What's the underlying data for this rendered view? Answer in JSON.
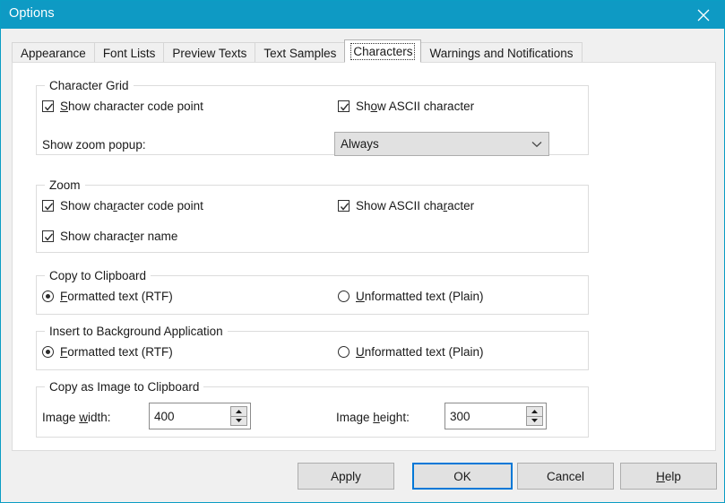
{
  "window": {
    "title": "Options",
    "close_icon": "close-icon",
    "accent_color": "#0e9ac4"
  },
  "tabs": [
    {
      "label": "Appearance",
      "active": false
    },
    {
      "label": "Font Lists",
      "active": false
    },
    {
      "label": "Preview Texts",
      "active": false
    },
    {
      "label": "Text Samples",
      "active": false
    },
    {
      "label": "Characters",
      "active": true
    },
    {
      "label": "Warnings and Notifications",
      "active": false
    }
  ],
  "groups": {
    "character_grid": {
      "legend": "Character Grid",
      "show_code_point": {
        "label": "Show character code point",
        "accel": "S",
        "checked": true
      },
      "show_ascii": {
        "label": "Show ASCII character",
        "accel": "o",
        "checked": true
      },
      "zoom_popup_label": "Show zoom popup:",
      "zoom_popup_value": "Always",
      "zoom_popup_options": [
        "Always"
      ],
      "dropdown_icon": "chevron-down-icon"
    },
    "zoom": {
      "legend": "Zoom",
      "show_code_point": {
        "label": "Show character code point",
        "accel": "r",
        "checked": true
      },
      "show_ascii": {
        "label": "Show ASCII character",
        "accel": "r",
        "checked": true
      },
      "show_name": {
        "label": "Show character name",
        "accel": "t",
        "checked": true
      }
    },
    "copy_to_clipboard": {
      "legend": "Copy to Clipboard",
      "formatted": {
        "label": "Formatted text (RTF)",
        "accel": "F",
        "selected": true
      },
      "unformatted": {
        "label": "Unformatted text (Plain)",
        "accel": "U",
        "selected": false
      }
    },
    "insert_to_background": {
      "legend": "Insert to Background Application",
      "formatted": {
        "label": "Formatted text (RTF)",
        "accel": "F",
        "selected": true
      },
      "unformatted": {
        "label": "Unformatted text (Plain)",
        "accel": "U",
        "selected": false
      }
    },
    "copy_as_image": {
      "legend": "Copy as Image to Clipboard",
      "width_label": "Image width:",
      "width_accel": "w",
      "width_value": "400",
      "height_label": "Image height:",
      "height_accel": "h",
      "height_value": "300",
      "up_icon": "triangle-up-icon",
      "down_icon": "triangle-down-icon"
    }
  },
  "buttons": {
    "apply": "Apply",
    "ok": "OK",
    "cancel": "Cancel",
    "help": "Help",
    "help_accel": "H",
    "default": "OK"
  }
}
